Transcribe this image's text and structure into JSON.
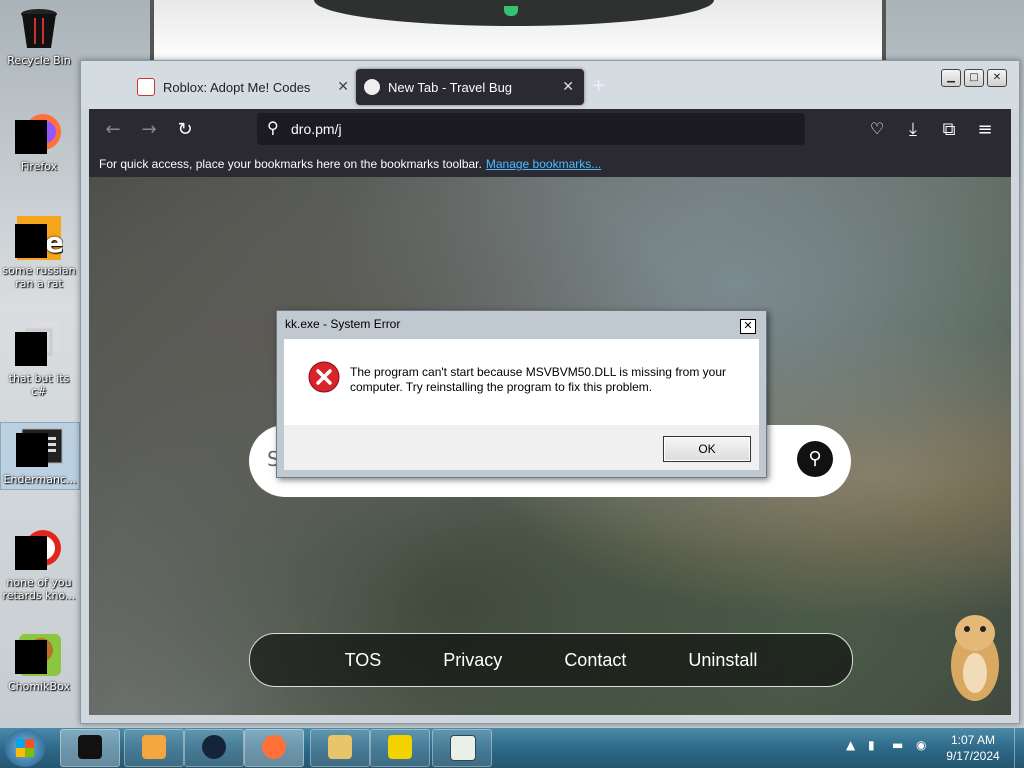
{
  "desktop": {
    "icons": [
      {
        "label": "Recycle Bin"
      },
      {
        "label": "Firefox"
      },
      {
        "label": "some russian ran a rat"
      },
      {
        "label": "that but its c#"
      },
      {
        "label": "Endermanc..."
      },
      {
        "label": "none of you retards kno..."
      },
      {
        "label": "ChomikBox"
      }
    ]
  },
  "browser": {
    "tabs": [
      {
        "label": "Roblox: Adopt Me! Codes",
        "close": "✕"
      },
      {
        "label": "New Tab - Travel Bug",
        "close": "✕"
      }
    ],
    "new_tab": "+",
    "window_controls": {
      "minimize": "▁",
      "maximize": "□",
      "close": "✕"
    },
    "url": "dro.pm/j",
    "bookmarks_bar": {
      "text": "For quick access, place your bookmarks here on the bookmarks toolbar.",
      "link": "Manage bookmarks..."
    },
    "page": {
      "search_placeholder": "S",
      "footer_links": [
        "TOS",
        "Privacy",
        "Contact",
        "Uninstall"
      ]
    }
  },
  "dialog": {
    "title": "kk.exe - System Error",
    "message": "The program can't start because MSVBVM50.DLL is missing from your computer. Try reinstalling the program to fix this problem.",
    "ok_label": "OK",
    "close_label": "✕"
  },
  "taskbar": {
    "time": "1:07 AM",
    "date": "9/17/2024"
  },
  "colors": {
    "browser_dark": "#2b2a33",
    "link": "#4dbbff",
    "error_red": "#d8242b"
  }
}
